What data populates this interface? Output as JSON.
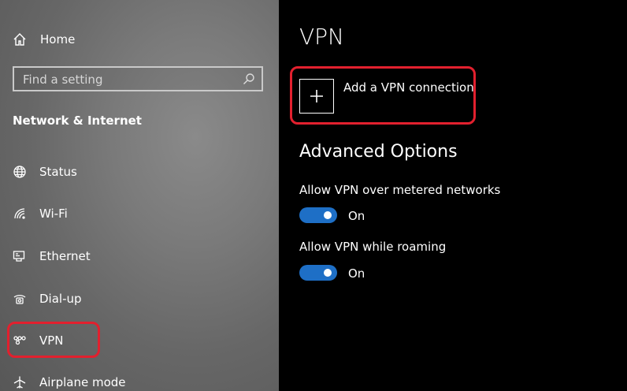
{
  "sidebar": {
    "home_label": "Home",
    "search_placeholder": "Find a setting",
    "section_title": "Network & Internet",
    "items": [
      {
        "label": "Status",
        "icon": "globe-icon"
      },
      {
        "label": "Wi-Fi",
        "icon": "wifi-icon"
      },
      {
        "label": "Ethernet",
        "icon": "ethernet-icon"
      },
      {
        "label": "Dial-up",
        "icon": "dialup-icon"
      },
      {
        "label": "VPN",
        "icon": "vpn-icon",
        "selected": true
      },
      {
        "label": "Airplane mode",
        "icon": "airplane-icon"
      }
    ]
  },
  "main": {
    "title": "VPN",
    "add_connection_label": "Add a VPN connection",
    "advanced_title": "Advanced Options",
    "options": [
      {
        "label": "Allow VPN over metered networks",
        "state": "On",
        "enabled": true
      },
      {
        "label": "Allow VPN while roaming",
        "state": "On",
        "enabled": true
      }
    ]
  },
  "colors": {
    "accent": "#1e6fc6",
    "highlight": "#e2202e"
  }
}
